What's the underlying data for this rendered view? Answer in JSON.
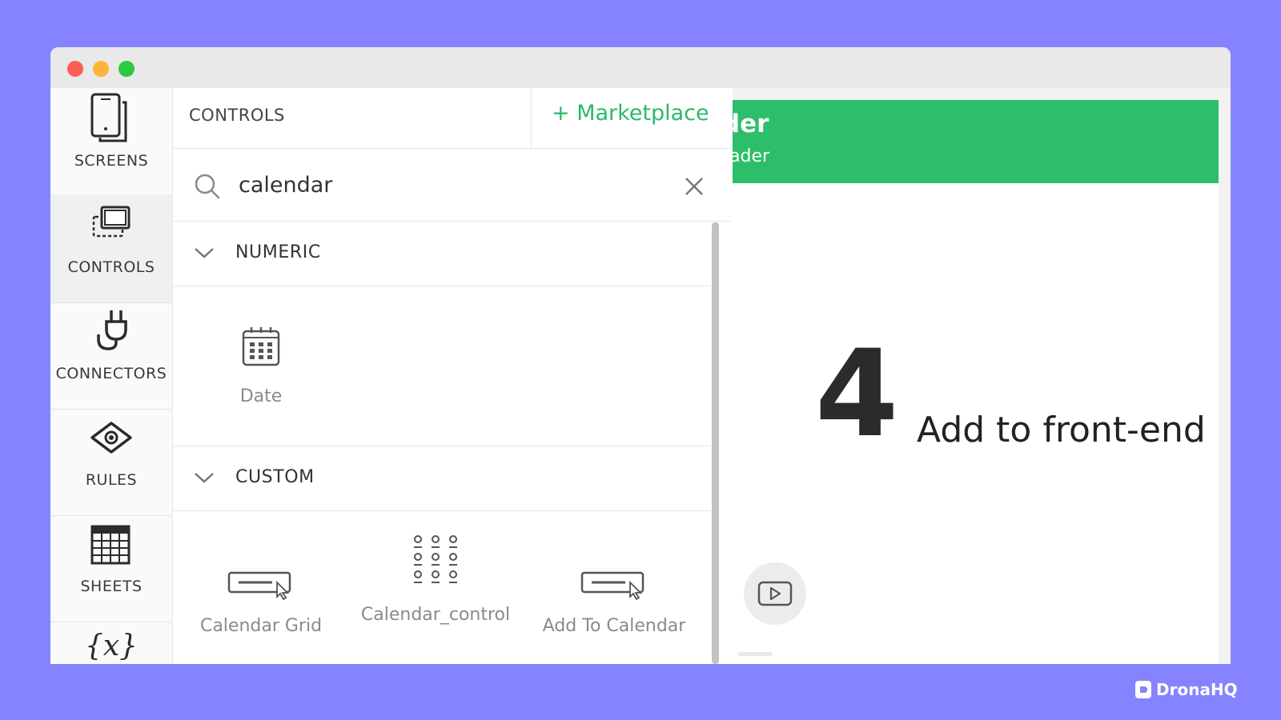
{
  "window": {
    "controls": [
      "close",
      "minimize",
      "maximize"
    ]
  },
  "sidebar": {
    "items": [
      {
        "label": "SCREENS",
        "icon": "mobile-screens-icon"
      },
      {
        "label": "CONTROLS",
        "icon": "controls-icon",
        "active": true
      },
      {
        "label": "CONNECTORS",
        "icon": "plug-icon"
      },
      {
        "label": "RULES",
        "icon": "eye-icon"
      },
      {
        "label": "SHEETS",
        "icon": "table-icon"
      },
      {
        "label": "",
        "icon": "variables-icon",
        "glyph": "{x}"
      }
    ]
  },
  "controls_panel": {
    "title": "CONTROLS",
    "marketplace_label": "+ Marketplace",
    "search": {
      "value": "calendar",
      "placeholder": ""
    },
    "sections": [
      {
        "title": "NUMERIC",
        "items": [
          {
            "label": "Date",
            "icon": "calendar-icon"
          }
        ]
      },
      {
        "title": "CUSTOM",
        "items": [
          {
            "label": "Calendar Grid",
            "icon": "button-cursor-icon"
          },
          {
            "label": "Calendar_control",
            "icon": "dot-grid-icon"
          },
          {
            "label": "Add To Calendar",
            "icon": "button-cursor-icon"
          }
        ]
      }
    ]
  },
  "preview": {
    "header_title": "ader",
    "header_subtitle": "Header",
    "play_icon": "play-icon"
  },
  "overlay": {
    "step_number": "4",
    "step_caption": "Add to front-end"
  },
  "brand": {
    "name": "DronaHQ"
  },
  "colors": {
    "background": "#8583ff",
    "accent_green": "#2cbe69",
    "marketplace_green": "#2bb96a"
  }
}
